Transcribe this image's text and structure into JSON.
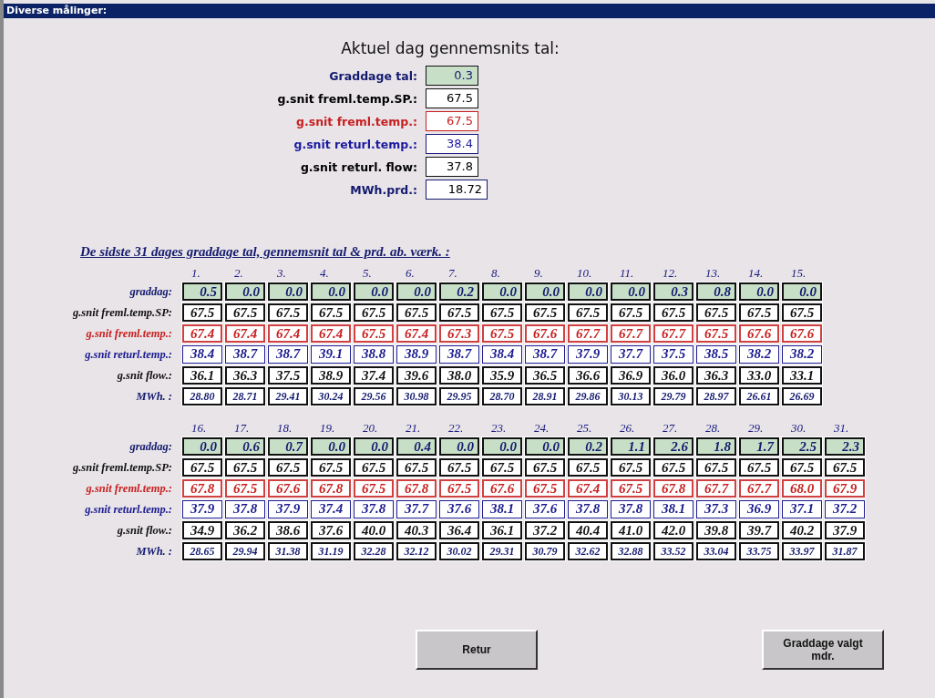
{
  "window": {
    "title": "Diverse målinger:"
  },
  "summary": {
    "heading": "Aktuel dag gennemsnits tal:",
    "rows": [
      {
        "label": "Graddage tal:",
        "value": "0.3",
        "kind": "graddag"
      },
      {
        "label": "g.snit freml.temp.SP.:",
        "value": "67.5",
        "kind": "setpoint"
      },
      {
        "label": "g.snit freml.temp.:",
        "value": "67.5",
        "kind": "supply"
      },
      {
        "label": "g.snit returl.temp.:",
        "value": "38.4",
        "kind": "return"
      },
      {
        "label": "g.snit returl. flow:",
        "value": "37.8",
        "kind": "flow"
      },
      {
        "label": "MWh.prd.:",
        "value": "18.72",
        "kind": "energy"
      }
    ]
  },
  "history": {
    "heading": "De sidste 31 dages graddage tal, gennemsnit tal & prd. ab. værk. :",
    "blocks": [
      {
        "days": [
          "1.",
          "2.",
          "3.",
          "4.",
          "5.",
          "6.",
          "7.",
          "8.",
          "9.",
          "10.",
          "11.",
          "12.",
          "13.",
          "14.",
          "15."
        ],
        "rows": [
          {
            "label": "graddag:",
            "kind": "graddag",
            "values": [
              "0.5",
              "0.0",
              "0.0",
              "0.0",
              "0.0",
              "0.0",
              "0.2",
              "0.0",
              "0.0",
              "0.0",
              "0.0",
              "0.3",
              "0.8",
              "0.0",
              "0.0"
            ]
          },
          {
            "label": "g.snit freml.temp.SP:",
            "kind": "setpoint",
            "values": [
              "67.5",
              "67.5",
              "67.5",
              "67.5",
              "67.5",
              "67.5",
              "67.5",
              "67.5",
              "67.5",
              "67.5",
              "67.5",
              "67.5",
              "67.5",
              "67.5",
              "67.5"
            ]
          },
          {
            "label": "g.snit freml.temp.:",
            "kind": "supply",
            "values": [
              "67.4",
              "67.4",
              "67.4",
              "67.4",
              "67.5",
              "67.4",
              "67.3",
              "67.5",
              "67.6",
              "67.7",
              "67.7",
              "67.7",
              "67.5",
              "67.6",
              "67.6"
            ]
          },
          {
            "label": "g.snit returl.temp.:",
            "kind": "return",
            "values": [
              "38.4",
              "38.7",
              "38.7",
              "39.1",
              "38.8",
              "38.9",
              "38.7",
              "38.4",
              "38.7",
              "37.9",
              "37.7",
              "37.5",
              "38.5",
              "38.2",
              "38.2"
            ]
          },
          {
            "label": "g.snit flow.:",
            "kind": "flow",
            "values": [
              "36.1",
              "36.3",
              "37.5",
              "38.9",
              "37.4",
              "39.6",
              "38.0",
              "35.9",
              "36.5",
              "36.6",
              "36.9",
              "36.0",
              "36.3",
              "33.0",
              "33.1"
            ]
          },
          {
            "label": "MWh. :",
            "kind": "energy",
            "values": [
              "28.80",
              "28.71",
              "29.41",
              "30.24",
              "29.56",
              "30.98",
              "29.95",
              "28.70",
              "28.91",
              "29.86",
              "30.13",
              "29.79",
              "28.97",
              "26.61",
              "26.69"
            ]
          }
        ]
      },
      {
        "days": [
          "16.",
          "17.",
          "18.",
          "19.",
          "20.",
          "21.",
          "22.",
          "23.",
          "24.",
          "25.",
          "26.",
          "27.",
          "28.",
          "29.",
          "30.",
          "31."
        ],
        "rows": [
          {
            "label": "graddag:",
            "kind": "graddag",
            "values": [
              "0.0",
              "0.6",
              "0.7",
              "0.0",
              "0.0",
              "0.4",
              "0.0",
              "0.0",
              "0.0",
              "0.2",
              "1.1",
              "2.6",
              "1.8",
              "1.7",
              "2.5",
              "2.3"
            ]
          },
          {
            "label": "g.snit freml.temp.SP:",
            "kind": "setpoint",
            "values": [
              "67.5",
              "67.5",
              "67.5",
              "67.5",
              "67.5",
              "67.5",
              "67.5",
              "67.5",
              "67.5",
              "67.5",
              "67.5",
              "67.5",
              "67.5",
              "67.5",
              "67.5",
              "67.5"
            ]
          },
          {
            "label": "g.snit freml.temp.:",
            "kind": "supply",
            "values": [
              "67.8",
              "67.5",
              "67.6",
              "67.8",
              "67.5",
              "67.8",
              "67.5",
              "67.6",
              "67.5",
              "67.4",
              "67.5",
              "67.8",
              "67.7",
              "67.7",
              "68.0",
              "67.9"
            ]
          },
          {
            "label": "g.snit returl.temp.:",
            "kind": "return",
            "values": [
              "37.9",
              "37.8",
              "37.9",
              "37.4",
              "37.8",
              "37.7",
              "37.6",
              "38.1",
              "37.6",
              "37.8",
              "37.8",
              "38.1",
              "37.3",
              "36.9",
              "37.1",
              "37.2"
            ]
          },
          {
            "label": "g.snit flow.:",
            "kind": "flow",
            "values": [
              "34.9",
              "36.2",
              "38.6",
              "37.6",
              "40.0",
              "40.3",
              "36.4",
              "36.1",
              "37.2",
              "40.4",
              "41.0",
              "42.0",
              "39.8",
              "39.7",
              "40.2",
              "37.9"
            ]
          },
          {
            "label": "MWh. :",
            "kind": "energy",
            "values": [
              "28.65",
              "29.94",
              "31.38",
              "31.19",
              "32.28",
              "32.12",
              "30.02",
              "29.31",
              "30.79",
              "32.62",
              "32.88",
              "33.52",
              "33.04",
              "33.75",
              "33.97",
              "31.87"
            ]
          }
        ]
      }
    ]
  },
  "buttons": [
    "Retur",
    "Graddage valgt mdr."
  ]
}
